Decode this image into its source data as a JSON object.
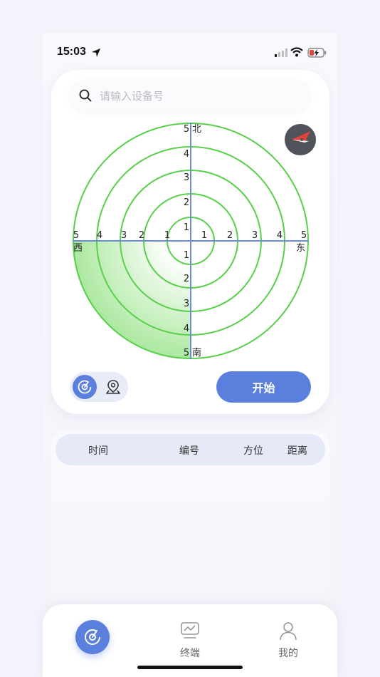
{
  "status_bar": {
    "time": "15:03",
    "icons": [
      "location-arrow-icon",
      "cellular-signal-icon",
      "wifi-icon",
      "battery-charging-icon"
    ]
  },
  "search": {
    "placeholder": "请输入设备号",
    "value": ""
  },
  "radar": {
    "rings": [
      1,
      2,
      3,
      4,
      5
    ],
    "directions": {
      "north": "北",
      "south": "南",
      "east": "东",
      "west": "西"
    },
    "sector": "southwest",
    "colors": {
      "ring": "#58d04a",
      "axis": "#6b8fd6",
      "sector": "#8fe07f"
    }
  },
  "mode_toggle": {
    "active": "radar-icon",
    "inactive": "map-pin-icon"
  },
  "start_label": "开始",
  "table": {
    "columns": [
      "时间",
      "编号",
      "方位",
      "距离"
    ],
    "rows": []
  },
  "tab_bar": {
    "items": [
      {
        "label": "",
        "icon": "radar-icon",
        "active": true
      },
      {
        "label": "终端",
        "icon": "terminal-chart-icon",
        "active": false
      },
      {
        "label": "我的",
        "icon": "user-icon",
        "active": false
      }
    ]
  },
  "colors": {
    "accent": "#5b7fdc",
    "background": "#f3f3fc"
  }
}
